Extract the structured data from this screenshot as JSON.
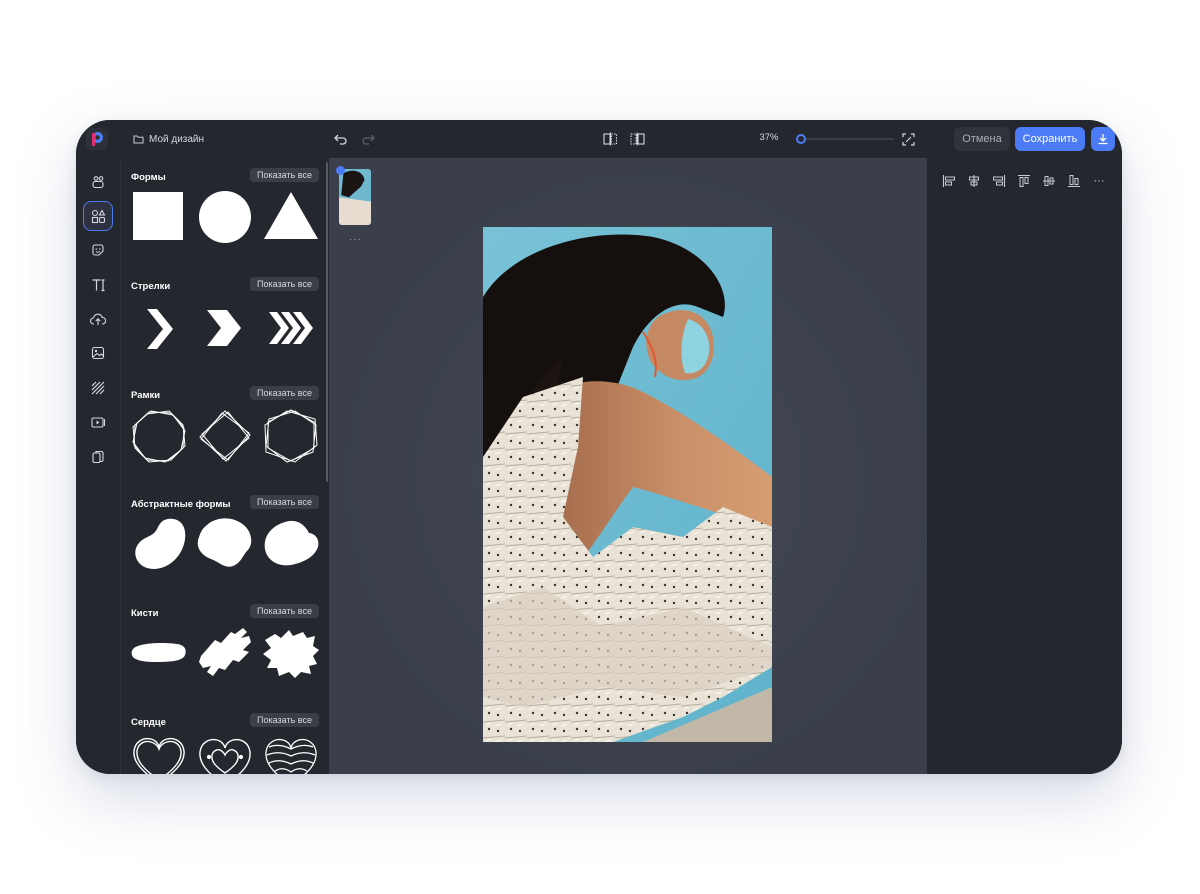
{
  "app": {
    "doc_name": "Мой дизайн",
    "accent": "#4b7bf5",
    "brand_icon": "photo-editor-logo-icon"
  },
  "topbar": {
    "undo_icon": "undo-icon",
    "redo_icon": "redo-icon",
    "zoom": "37%",
    "zoom_level": 0.0,
    "cancel_label": "Отмена",
    "save_label": "Сохранить"
  },
  "toolrail": {
    "items": [
      {
        "icon": "template-icon",
        "active": false
      },
      {
        "icon": "shapes-icon",
        "active": true
      },
      {
        "icon": "sticker-icon",
        "active": false
      },
      {
        "icon": "text-icon",
        "active": false
      },
      {
        "icon": "upload-icon",
        "active": false
      },
      {
        "icon": "image-icon",
        "active": false
      },
      {
        "icon": "background-icon",
        "active": false
      },
      {
        "icon": "video-icon",
        "active": false
      },
      {
        "icon": "layers-icon",
        "active": false
      }
    ]
  },
  "panel": {
    "show_all_label": "Показать все",
    "sections": [
      {
        "title": "Формы"
      },
      {
        "title": "Стрелки"
      },
      {
        "title": "Рамки"
      },
      {
        "title": "Абстрактные формы"
      },
      {
        "title": "Кисти"
      },
      {
        "title": "Сердце"
      }
    ]
  },
  "pages": {
    "more_label": "···"
  },
  "alignment": {
    "icons": [
      "align-left-icon",
      "align-center-h-icon",
      "align-right-icon",
      "align-top-icon",
      "align-middle-v-icon",
      "align-bottom-icon",
      "more-icon"
    ],
    "more_label": "···"
  }
}
